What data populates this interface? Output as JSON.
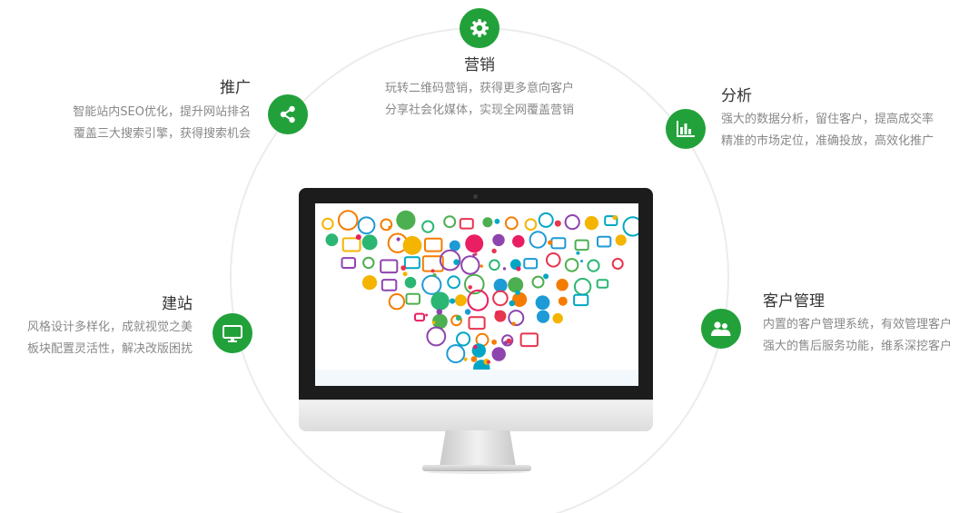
{
  "colors": {
    "accent_green": "#22a13a",
    "title_text": "#333333",
    "desc_text": "#888888",
    "ring": "#ececec"
  },
  "features": {
    "marketing": {
      "icon": "gear-icon",
      "title": "营销",
      "lines": [
        "玩转二维码营销，获得更多意向客户",
        "分享社会化媒体，实现全网覆盖营销"
      ]
    },
    "promotion": {
      "icon": "share-icon",
      "title": "推广",
      "lines": [
        "智能站内SEO优化，提升网站排名",
        "覆盖三大搜索引擎，获得搜索机会"
      ]
    },
    "analysis": {
      "icon": "bar-chart-icon",
      "title": "分析",
      "lines": [
        "强大的数据分析，留住客户，提高成交率",
        "精准的市场定位，准确投放，高效化推广"
      ]
    },
    "site_building": {
      "icon": "monitor-icon",
      "title": "建站",
      "lines": [
        "风格设计多样化，成就视觉之美",
        "板块配置灵活性，解决改版困扰"
      ]
    },
    "crm": {
      "icon": "users-icon",
      "title": "客户管理",
      "lines": [
        "内置的客户管理系统，有效管理客户",
        "强大的售后服务功能，维系深挖客户"
      ]
    }
  },
  "monitor": {
    "illustration": "colorful-app-icons-cloud"
  }
}
